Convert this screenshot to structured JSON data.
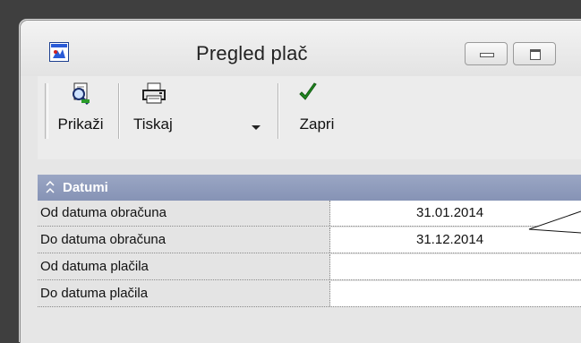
{
  "window": {
    "title": "Pregled plač",
    "app_icon": "report-app-icon",
    "controls": [
      {
        "name": "minimize",
        "icon": "minimize-icon"
      },
      {
        "name": "maximize",
        "icon": "maximize-icon"
      }
    ]
  },
  "toolbar": {
    "buttons": [
      {
        "label": "Prikaži",
        "icon": "preview-magnifier-icon"
      },
      {
        "label": "Tiskaj",
        "icon": "printer-icon"
      },
      {
        "label": "Zapri",
        "icon": "checkmark-icon"
      }
    ]
  },
  "section": {
    "label": "Datumi",
    "icon": "collapse-chevrons-icon",
    "header_color": "#8a97b9"
  },
  "rows": [
    {
      "label": "Od datuma obračuna",
      "value": "31.01.2014"
    },
    {
      "label": "Do datuma obračuna",
      "value": "31.12.2014"
    },
    {
      "label": "Od datuma plačila",
      "value": ""
    },
    {
      "label": "Do datuma plačila",
      "value": ""
    }
  ],
  "colors": {
    "background": "#3f3f3f",
    "checkmark": "#1f8a1f"
  }
}
